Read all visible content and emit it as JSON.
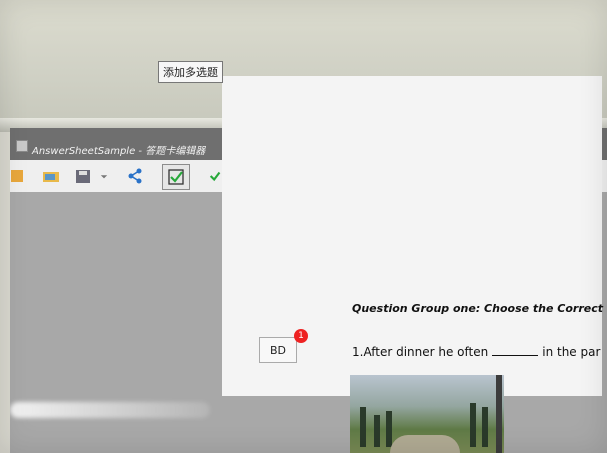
{
  "window": {
    "title": "AnswerSheetSample - 答题卡编辑器"
  },
  "toolbar": {
    "buttons": [
      {
        "icon": "new-file-icon"
      },
      {
        "icon": "open-folder-icon"
      },
      {
        "icon": "save-icon"
      },
      {
        "icon": "dropdown-icon"
      },
      {
        "icon": "share-icon"
      },
      {
        "icon": "multi-choice-icon",
        "active": true
      },
      {
        "icon": "true-false-icon"
      },
      {
        "icon": "blank-icon"
      },
      {
        "icon": "lines-icon"
      },
      {
        "icon": "pen-icon"
      },
      {
        "icon": "hand-icon"
      },
      {
        "icon": "cursor-icon"
      },
      {
        "icon": "settings-icon"
      }
    ],
    "tooltip": "添加多选题"
  },
  "document": {
    "question_group_heading": "Question Group one: Choose the Correct",
    "question_prefix": "1.After dinner he often",
    "question_suffix": "in the par",
    "answer_badge": "BD",
    "notification_count": "1"
  },
  "colors": {
    "accent_green": "#27a83a",
    "accent_red": "#e02020",
    "accent_blue": "#2a72c8"
  }
}
